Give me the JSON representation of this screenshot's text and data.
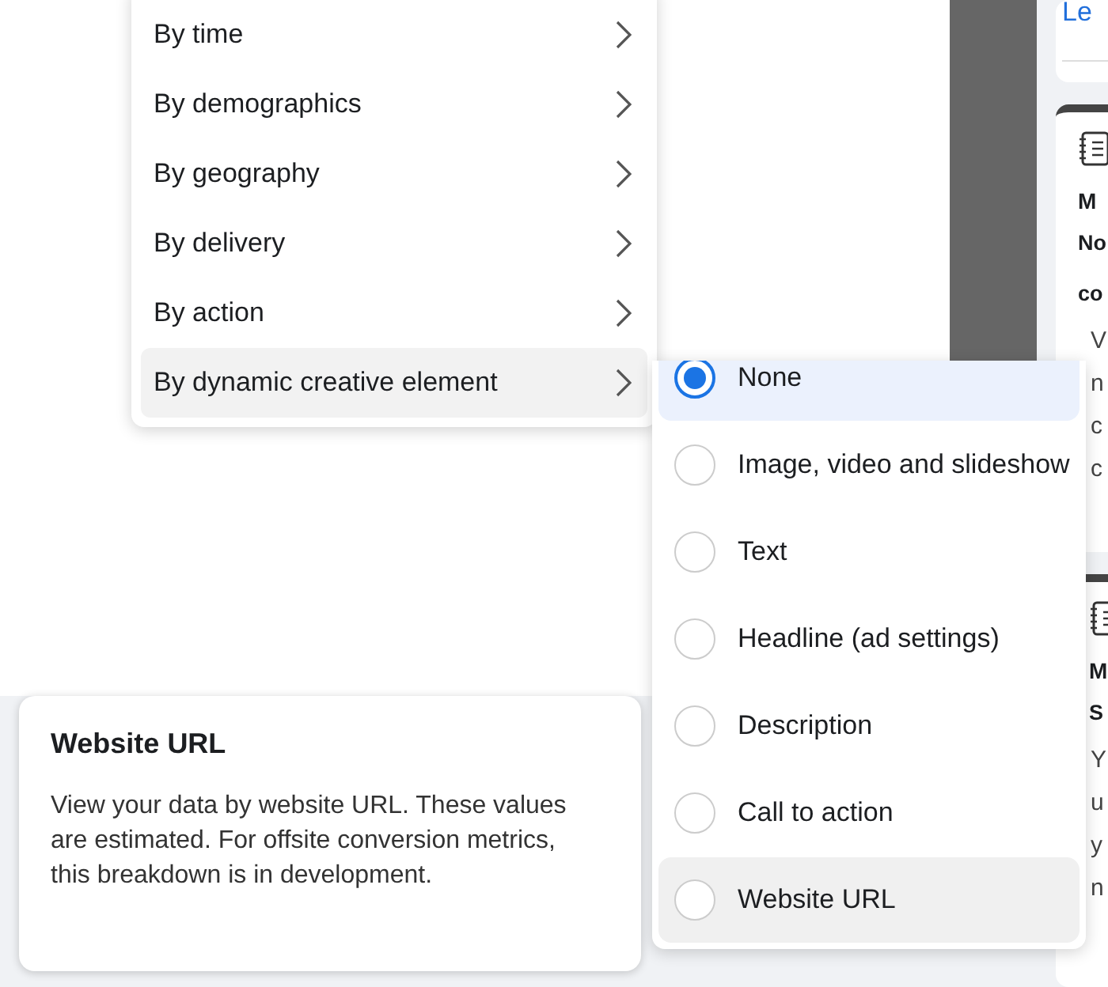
{
  "breakdown_menu": {
    "items": [
      {
        "label": "By time",
        "selected": false
      },
      {
        "label": "By demographics",
        "selected": false
      },
      {
        "label": "By geography",
        "selected": false
      },
      {
        "label": "By delivery",
        "selected": false
      },
      {
        "label": "By action",
        "selected": false
      },
      {
        "label": "By dynamic creative element",
        "selected": true
      }
    ]
  },
  "submenu": {
    "options": [
      {
        "label": "None",
        "checked": true,
        "selected": false
      },
      {
        "label": "Image, video and slideshow",
        "checked": false,
        "selected": false
      },
      {
        "label": "Text",
        "checked": false,
        "selected": false
      },
      {
        "label": "Headline (ad settings)",
        "checked": false,
        "selected": false
      },
      {
        "label": "Description",
        "checked": false,
        "selected": false
      },
      {
        "label": "Call to action",
        "checked": false,
        "selected": false
      },
      {
        "label": "Website URL",
        "checked": false,
        "selected": true
      }
    ]
  },
  "tooltip": {
    "title": "Website URL",
    "text": "View your data by website URL. These values are estimated. For offsite conversion metrics, this breakdown is in development."
  },
  "side_cards": [
    {
      "link": "Le"
    },
    {
      "title": "M",
      "heading": [
        "No",
        "co"
      ],
      "body": [
        "V",
        "n",
        "c",
        "c"
      ]
    },
    {
      "title": "M",
      "heading": [
        "S"
      ],
      "body": [
        "Y",
        "u",
        "y",
        "n"
      ]
    }
  ]
}
